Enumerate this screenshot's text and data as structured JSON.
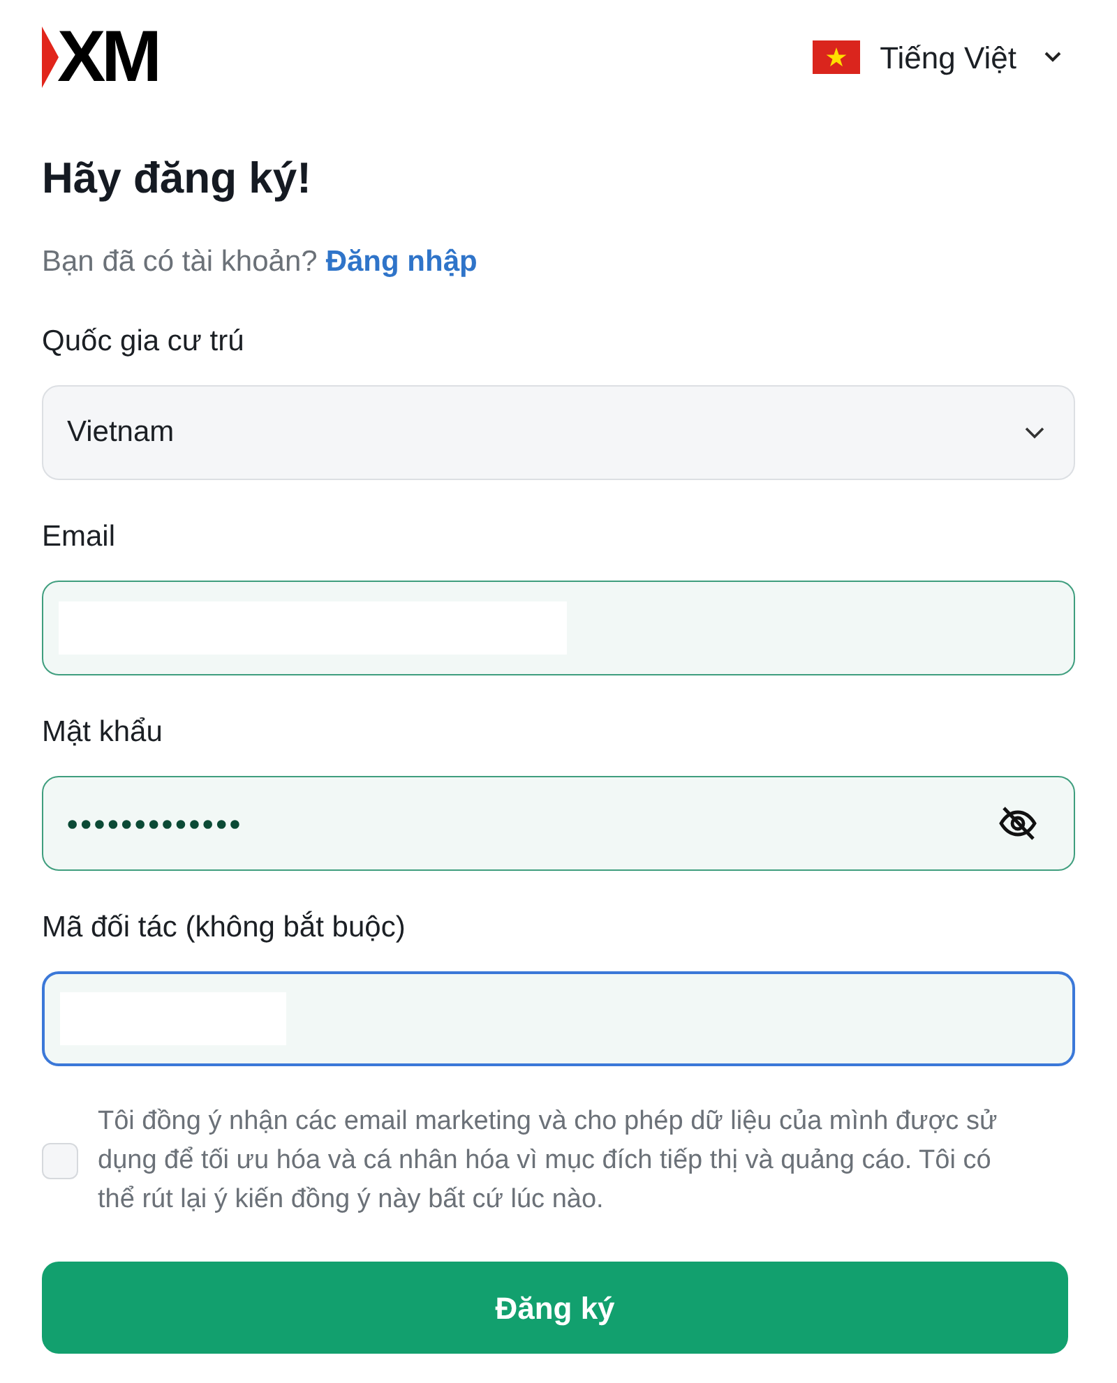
{
  "header": {
    "logo": "XM",
    "language": {
      "label": "Tiếng Việt"
    }
  },
  "title": "Hãy đăng ký!",
  "login_prompt": {
    "text": "Bạn đã có tài khoản?",
    "link": "Đăng nhập"
  },
  "fields": [
    {
      "kind": "select",
      "label": "Quốc gia cư trú",
      "value": "Vietnam",
      "valid": false,
      "focused": false
    },
    {
      "kind": "text",
      "label": "Email",
      "redacted": true,
      "valid": true,
      "focused": false
    },
    {
      "kind": "password",
      "label": "Mật khẩu",
      "value": "•••••••••••••",
      "valid": true,
      "focused": false
    },
    {
      "kind": "text",
      "label": "Mã đối tác (không bắt buộc)",
      "redacted": true,
      "valid": true,
      "focused": true
    }
  ],
  "consent": {
    "checked": false,
    "text": "Tôi đồng ý nhận các email marketing và cho phép dữ liệu của mình được sử dụng để tối ưu hóa và cá nhân hóa vì mục đích tiếp thị và quảng cáo. Tôi có thể rút lại ý kiến đồng ý này bất cứ lúc nào."
  },
  "submit": "Đăng ký"
}
